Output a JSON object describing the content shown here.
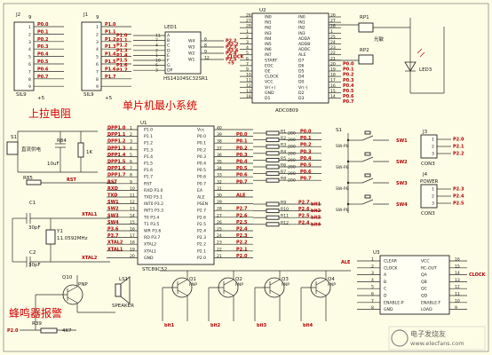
{
  "labels": {
    "pullup": "上拉电阻",
    "mcu_system": "单片机最小系统",
    "buzzer": "蜂鸣器报警"
  },
  "connectors": {
    "j2": {
      "ref": "J2",
      "name": "9",
      "foot": "SIL9",
      "nets": [
        "P0.0",
        "P0.1",
        "P0.2",
        "P0.3",
        "P0.4",
        "P0.5",
        "P0.6",
        "P0.7"
      ],
      "pins": [
        "1",
        "2",
        "3",
        "4",
        "5",
        "6",
        "7",
        "8",
        "9"
      ]
    },
    "j1": {
      "ref": "J1",
      "name": "9",
      "foot": "SIL9",
      "nets": [
        "P1.0",
        "P1.1",
        "P1.2",
        "P1.3",
        "P1.4",
        "P1.5",
        "P1.6",
        "P1.7"
      ],
      "pins": [
        "1",
        "2",
        "3",
        "4",
        "5",
        "6",
        "7",
        "8",
        "9"
      ]
    },
    "vcc": "+5"
  },
  "lcd": {
    "ref": "LED1",
    "foot": "HS14104SC32SR1",
    "left_pins": [
      "A",
      "B",
      "C",
      "D",
      "E",
      "F",
      "G",
      "DP"
    ],
    "left_nums": [
      "11",
      "7",
      "4",
      "2",
      "1",
      "10",
      "5",
      "3"
    ],
    "right_pins": [
      "W4",
      "W3",
      "W2",
      "W1"
    ],
    "right_nums": [
      "6",
      "8",
      "9",
      "12"
    ],
    "right_nets": [
      "P2.2",
      "P2.3",
      "P2.4",
      "P2.5"
    ],
    "left_nets": [
      "P1.0",
      "P1.1",
      "P1.2",
      "P1.3",
      "P1.4",
      "P1.5",
      "P1.6",
      "P1.7"
    ]
  },
  "adc": {
    "ref": "U2",
    "part": "ADC0809",
    "left_pins": [
      "IN0",
      "IN1",
      "IN2",
      "IN3",
      "IN4",
      "IN5",
      "IN6",
      "IN7",
      "START",
      "EOC",
      "OE",
      "CLOCK",
      "VCC",
      "Vr(+)",
      "GND",
      "D1"
    ],
    "left_nums": [
      "26",
      "27",
      "28",
      "1",
      "2",
      "3",
      "4",
      "5",
      "6",
      "7",
      "9",
      "10",
      "11",
      "12",
      "13",
      "18"
    ],
    "right_pins": [
      "IN0",
      "IN1",
      "IN2",
      "IN3",
      "ADDA",
      "ADDB",
      "ADDC",
      "ALE",
      "D7",
      "D6",
      "D5",
      "D4",
      "D0",
      "Vr(-)",
      "D2",
      "D3"
    ],
    "right_nums": [
      "26",
      "27",
      "28",
      "1",
      "25",
      "24",
      "23",
      "22",
      "21",
      "20",
      "19",
      "18",
      "17",
      "16",
      "15",
      "14"
    ],
    "left_nets": [
      "P2.2",
      "P3.6",
      "CLOCK",
      "+5"
    ],
    "right_nets": [
      "P0.0",
      "P0.1",
      "P0.2",
      "P0.3",
      "P0.4",
      "P0.5",
      "P0.6",
      "P0.7"
    ]
  },
  "rp": {
    "rp1": "RP1",
    "rp2": "RP2",
    "rp1_label": "光敏",
    "rp2_label": "",
    "led": "LED3"
  },
  "power": {
    "s1": "S1",
    "jack": "直流供电",
    "r84": "R84",
    "r84_val": "1K",
    "c3": "10uF",
    "rst": "RST",
    "r85": "R85",
    "c1": "C1",
    "c1_val": "30pF",
    "c2": "C2",
    "c2_val": "30pF",
    "y1": "Y1",
    "y1_val": "11.0592MHz",
    "xtal1": "XTAL1",
    "xtal2": "XTAL2",
    "gnd": "GND"
  },
  "mcu": {
    "ref": "U1",
    "part": "STC89C52",
    "left_pins": [
      "P1.0",
      "P1.1",
      "P1.2",
      "P1.3",
      "P1.4",
      "P1.5",
      "P1.6",
      "P1.7",
      "RST",
      "RXD P3.0",
      "TXD P3.1",
      "INT0 P3.2",
      "INT1 P3.3",
      "T0 P3.4",
      "T1 P3.5",
      "WR P3.6",
      "RD P3.7",
      "XTAL2",
      "XTAL1",
      "GND"
    ],
    "left_nums": [
      "1",
      "2",
      "3",
      "4",
      "5",
      "6",
      "7",
      "8",
      "9",
      "10",
      "11",
      "12",
      "13",
      "14",
      "15",
      "16",
      "17",
      "18",
      "19",
      "20"
    ],
    "left_nets": [
      "DPP1.0",
      "DPP1.1",
      "DPP1.2",
      "DPP1.3",
      "DPP1.4",
      "DPP1.5",
      "DPP1.6",
      "DPP1.7",
      "RST",
      "RXD",
      "TXD",
      "SW1",
      "SW2",
      "SW3",
      "SW4",
      "P3.6",
      "P3.7",
      "XTAL2",
      "XTAL1",
      ""
    ],
    "right_pins": [
      "Vcc",
      "P0.0",
      "P0.1",
      "P0.2",
      "P0.3",
      "P0.4",
      "P0.5",
      "P0.6",
      "P0.7",
      "EA",
      "ALE",
      "PSEN",
      "P2.7",
      "P2.6",
      "P2.5",
      "P2.4",
      "P2.3",
      "P2.2",
      "P2.1",
      "P2.0"
    ],
    "right_nums": [
      "40",
      "39",
      "38",
      "37",
      "36",
      "35",
      "34",
      "33",
      "32",
      "31",
      "30",
      "29",
      "28",
      "27",
      "26",
      "25",
      "24",
      "23",
      "22",
      "21"
    ],
    "right_nets": [
      "",
      "P0.0",
      "P0.1",
      "P0.2",
      "P0.3",
      "P0.4",
      "P0.5",
      "P0.6",
      "P0.7",
      "",
      "ALE",
      "",
      "P2.7",
      "P2.6",
      "P2.5",
      "P2.4",
      "P2.3",
      "P2.2",
      "P2.1",
      "P2.0"
    ]
  },
  "resistors": {
    "upper_refs": [
      "R1",
      "R2",
      "R3",
      "R4",
      "R5",
      "R6",
      "R7",
      "R8"
    ],
    "upper_val": "200",
    "upper_nets": [
      "P0.0",
      "P0.1",
      "P0.2",
      "P0.3",
      "P0.4",
      "P0.5",
      "P0.6",
      "P0.7"
    ],
    "lower_refs": [
      "R9",
      "R10",
      "R11",
      "R12"
    ],
    "lower_nets": [
      "P2.7",
      "P2.6",
      "P2.5",
      "P2.4"
    ],
    "lower_out": [
      "bit1",
      "bit2",
      "bit3",
      "bit4"
    ]
  },
  "switches": {
    "s1": "S1",
    "labels": [
      "SW-PB",
      "SW-PB",
      "SW-PB",
      "SW-PB"
    ],
    "nets": [
      "SW1",
      "SW2",
      "SW3",
      "SW4"
    ]
  },
  "j3": {
    "ref": "J3",
    "part": "CON3",
    "nets": [
      "P2.0",
      "P2.1",
      "P2.2"
    ],
    "pins": [
      "1",
      "2",
      "3"
    ]
  },
  "j4": {
    "ref": "J4",
    "part": "CON3",
    "title": "POWER",
    "nets": [
      "P2.3",
      "P2.4",
      "P2.5"
    ],
    "pins": [
      "1",
      "2",
      "3"
    ]
  },
  "transistors": {
    "q10": "Q10",
    "q10_type": "PNP",
    "q10_net": "P2.0",
    "r39": "R39",
    "r39_val": "4K7",
    "speaker": "LS1",
    "speaker_name": "SPEAKER",
    "q_refs": [
      "Q1",
      "Q2",
      "Q3",
      "Q4"
    ],
    "q_types": [
      "PNP",
      "PNP",
      "PNP",
      "PNP"
    ],
    "q_nets": [
      "bit1",
      "bit2",
      "bit3",
      "bit4"
    ]
  },
  "u3": {
    "ref": "U3",
    "left_pins": [
      "CLEAR",
      "CLOCK",
      "A",
      "B",
      "C",
      "D",
      "ENABLE-P",
      "GND"
    ],
    "left_nums": [
      "1",
      "2",
      "3",
      "4",
      "5",
      "6",
      "7",
      "8"
    ],
    "right_pins": [
      "VCC",
      "RC-OUT",
      "QA",
      "QB",
      "QC",
      "QD",
      "ENABLE-T",
      "LOAD"
    ],
    "right_nums": [
      "16",
      "15",
      "14",
      "13",
      "12",
      "11",
      "10",
      "9"
    ],
    "ale": "ALE",
    "clock": "CLOCK"
  },
  "watermark": "www.elecfans.com",
  "watermark_brand": "电子发烧友"
}
